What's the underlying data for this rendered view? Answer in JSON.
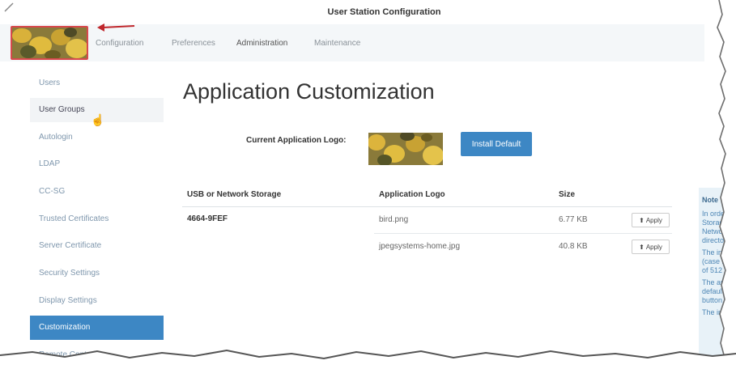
{
  "window": {
    "title": "User Station Configuration"
  },
  "topnav": {
    "tabs": [
      {
        "label": "Configuration"
      },
      {
        "label": "Preferences"
      },
      {
        "label": "Administration"
      },
      {
        "label": "Maintenance"
      }
    ]
  },
  "sidebar": {
    "items": [
      {
        "label": "Users"
      },
      {
        "label": "User Groups"
      },
      {
        "label": "Autologin"
      },
      {
        "label": "LDAP"
      },
      {
        "label": "CC-SG"
      },
      {
        "label": "Trusted Certificates"
      },
      {
        "label": "Server Certificate"
      },
      {
        "label": "Security Settings"
      },
      {
        "label": "Display Settings"
      },
      {
        "label": "Customization"
      },
      {
        "label": "Remote Control"
      }
    ]
  },
  "main": {
    "title": "Application Customization",
    "current_logo_label": "Current Application Logo:",
    "install_default_label": "Install Default",
    "table": {
      "headers": [
        "USB or Network Storage",
        "Application Logo",
        "Size"
      ],
      "storage": "4664-9FEF",
      "rows": [
        {
          "file": "bird.png",
          "size": "6.77 KB",
          "action": "Apply"
        },
        {
          "file": "jpegsystems-home.jpg",
          "size": "40.8 KB",
          "action": "Apply"
        }
      ]
    }
  },
  "note": {
    "title": "Note",
    "lines": [
      "In orde",
      "Storage",
      "Networ",
      "director",
      "The ind",
      "(case in",
      "of 512",
      "The app",
      "default i",
      "button.",
      "The ima"
    ]
  }
}
